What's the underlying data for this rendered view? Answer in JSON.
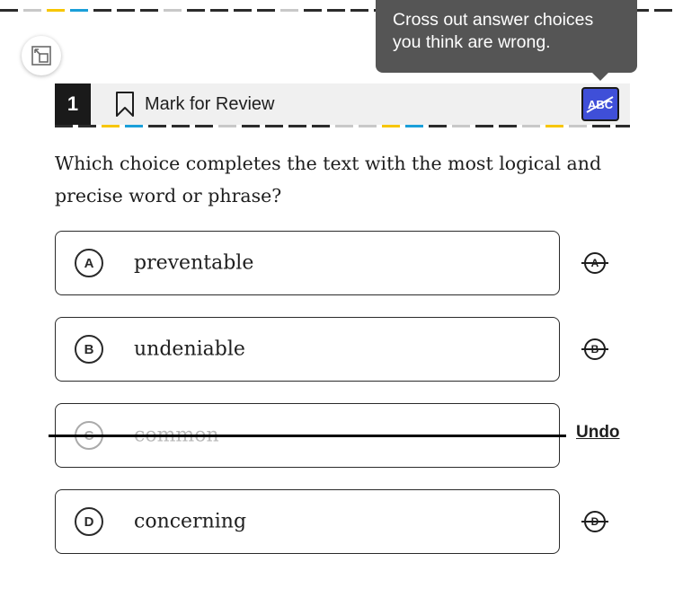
{
  "dash_colors": {
    "dark": "#2b2b2b",
    "light": "#c8c8c8",
    "yellow": "#f7c600",
    "blue": "#1a9fd9"
  },
  "header": {
    "question_number": "1",
    "mark_for_review_label": "Mark for Review",
    "bookmark_icon": "bookmark-icon",
    "cross_out_tool_icon": "abc-strikethrough-icon",
    "accent_color": "#3f4fd8"
  },
  "tooltip": {
    "line1": "Cross out answer choices",
    "line2": "you think are wrong."
  },
  "question": {
    "text": "Which choice completes the text with the most logical and precise word or phrase?"
  },
  "choices": [
    {
      "letter": "A",
      "text": "preventable",
      "crossed_out": false
    },
    {
      "letter": "B",
      "text": "undeniable",
      "crossed_out": false
    },
    {
      "letter": "C",
      "text": "common",
      "crossed_out": true
    },
    {
      "letter": "D",
      "text": "concerning",
      "crossed_out": false
    }
  ],
  "undo_label": "Undo",
  "expand_icon": "expand-collapse-icon"
}
